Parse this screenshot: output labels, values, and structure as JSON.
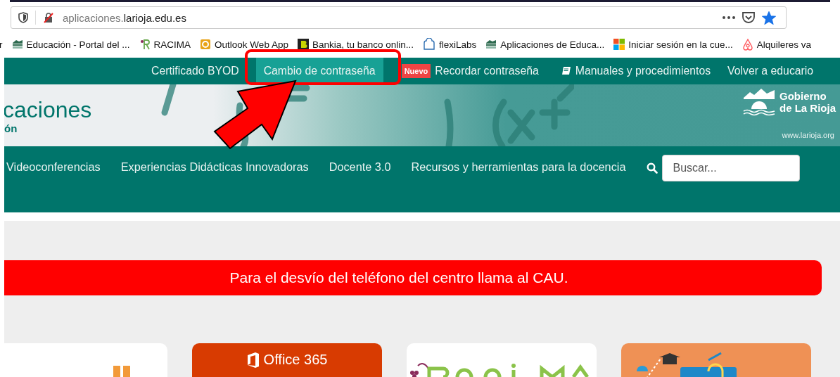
{
  "browser": {
    "url_prefix": "aplicaciones.",
    "url_domain": "larioja.edu.es",
    "bookmarked": true,
    "bookmarks": [
      "r",
      "Educación - Portal del ...",
      "RACIMA",
      "Outlook Web App",
      "Bankia, tu banco onlin...",
      "flexiLabs",
      "Aplicaciones de Educa...",
      "Iniciar sesión en la cue...",
      "Alquileres va"
    ]
  },
  "top_nav": [
    {
      "kind": "plain",
      "label": "Certificado BYOD",
      "selected": false
    },
    {
      "kind": "plain",
      "label": "Cambio de contraseña",
      "selected": true
    },
    {
      "kind": "new",
      "label": "Recordar contraseña",
      "selected": false,
      "badge": "Nuevo"
    },
    {
      "kind": "book",
      "label": "Manuales y procedimientos",
      "selected": false
    },
    {
      "kind": "plain",
      "label": "Volver a educario",
      "selected": false
    }
  ],
  "banner": {
    "title": "caciones",
    "subtitle": "ón",
    "logo_line_1": "Gobierno",
    "logo_line_2": "de La Rioja",
    "logo_url": "www.larioja.org"
  },
  "main_menu": [
    "Videoconferencias",
    "Experiencias Didácticas Innovadoras",
    "Docente 3.0",
    "Recursos y herramientas para la docencia"
  ],
  "search": {
    "placeholder": "Buscar..."
  },
  "alert": "Para el desvío del teléfono del centro llama al CAU.",
  "cards": [
    {
      "kind": "bars"
    },
    {
      "kind": "office",
      "title": "Office 365"
    },
    {
      "kind": "racima"
    },
    {
      "kind": "illustration"
    }
  ]
}
